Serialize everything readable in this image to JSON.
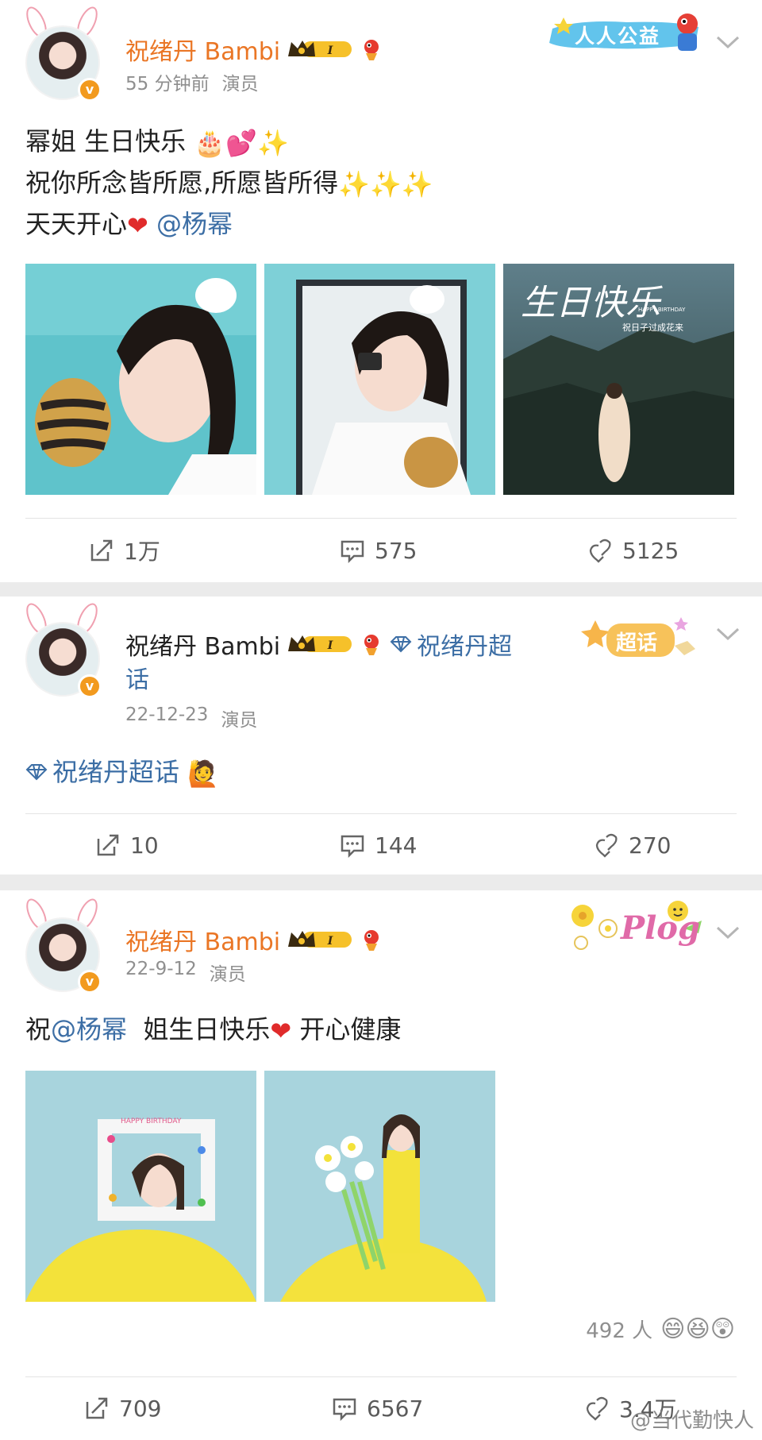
{
  "posts": [
    {
      "author": "祝绪丹 Bambi",
      "level": "I",
      "time": "55 分钟前",
      "role": "演员",
      "sticker_text": "人人公益",
      "text_lines": [
        {
          "before": "幂姐 生日快乐",
          "emojis": "🎂💕✨",
          "mention": "",
          "after": ""
        },
        {
          "before": "祝你所念皆所愿,所愿皆所得",
          "emojis": "✨✨✨",
          "mention": "",
          "after": ""
        },
        {
          "before": "天天开心",
          "emojis": "❤",
          "mention": "@杨幂",
          "after": ""
        }
      ],
      "image_overlay": {
        "title": "生日快乐",
        "subtitle": "祝日子过成花来",
        "small": "HAPPY BIRTHDAY"
      },
      "actions": {
        "repost": "1万",
        "comment": "575",
        "like": "5125"
      }
    },
    {
      "author": "祝绪丹 Bambi",
      "level": "I",
      "super_topic_line1": "祝绪丹超",
      "super_topic_line2": "话",
      "time": "22-12-23",
      "role": "演员",
      "sticker_text": "超话",
      "topic_text": "祝绪丹超话",
      "topic_emoji": "🙋",
      "actions": {
        "repost": "10",
        "comment": "144",
        "like": "270"
      }
    },
    {
      "author": "祝绪丹 Bambi",
      "level": "I",
      "time": "22-9-12",
      "role": "演员",
      "sticker_text": "Plog",
      "text_before": "祝",
      "mention": "@杨幂",
      "text_middle": "姐生日快乐",
      "text_emoji": "❤",
      "text_after": "开心健康",
      "image_frame_text": "HAPPY BIRTHDAY",
      "reactions_count": "492 人",
      "reaction_emojis": "😄😆😲",
      "actions": {
        "repost": "709",
        "comment": "6567",
        "like": "3.4万"
      }
    }
  ],
  "watermark": "@当代勤快人",
  "colors": {
    "name_orange": "#ea7625",
    "link_blue": "#3c6ea5",
    "meta_gray": "#8f8f8f",
    "separator": "#ebebeb"
  }
}
